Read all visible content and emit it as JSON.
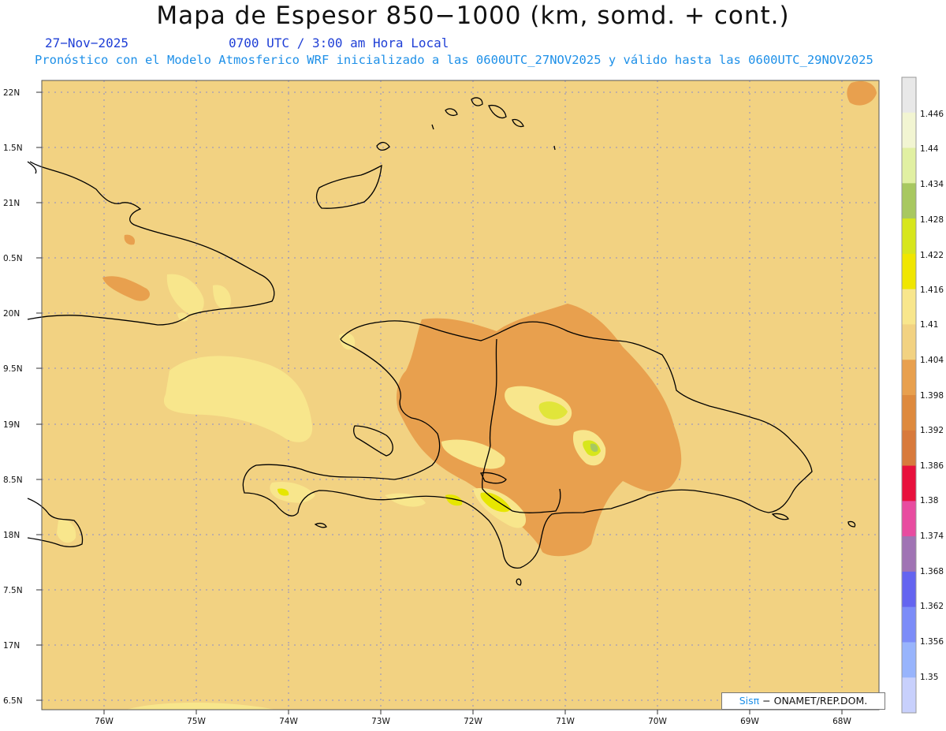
{
  "header": {
    "title": "Mapa de Espesor 850−1000 (km, somd. + cont.)",
    "date": "27−Nov−2025",
    "time": "0700 UTC / 3:00 am Hora Local",
    "subtitle": "Pronóstico con el Modelo Atmosferico WRF inicializado a las 0600UTC_27NOV2025 y válido hasta las  0600UTC_29NOV2025"
  },
  "axes": {
    "lat_labels": [
      "22N",
      "1.5N",
      "21N",
      "0.5N",
      "20N",
      "9.5N",
      "19N",
      "8.5N",
      "18N",
      "7.5N",
      "17N",
      "6.5N"
    ],
    "lon_labels": [
      "76W",
      "75W",
      "74W",
      "73W",
      "72W",
      "71W",
      "70W",
      "69W",
      "68W"
    ]
  },
  "colorbar": {
    "labels": [
      "1.446",
      "1.44",
      "1.434",
      "1.428",
      "1.422",
      "1.416",
      "1.41",
      "1.404",
      "1.398",
      "1.392",
      "1.386",
      "1.38",
      "1.374",
      "1.368",
      "1.362",
      "1.356",
      "1.35"
    ],
    "colors_top_to_bottom": [
      "#e8e8e8",
      "#f2f5d2",
      "#e1f0a2",
      "#a8c860",
      "#d7e61c",
      "#f0e600",
      "#f8e68c",
      "#f2d282",
      "#e8a04e",
      "#de8a3e",
      "#d87a3c",
      "#e8103c",
      "#e84ca0",
      "#a074b4",
      "#6464f0",
      "#7c8cf8",
      "#98b4fc",
      "#c8d0fc"
    ]
  },
  "map": {
    "background_color": "#f2d282",
    "coastline_color": "#000000",
    "grid_color": "#8c8cc8"
  },
  "credit": {
    "brand": "Sisπ",
    "org": " − ONAMET/REP.DOM."
  }
}
